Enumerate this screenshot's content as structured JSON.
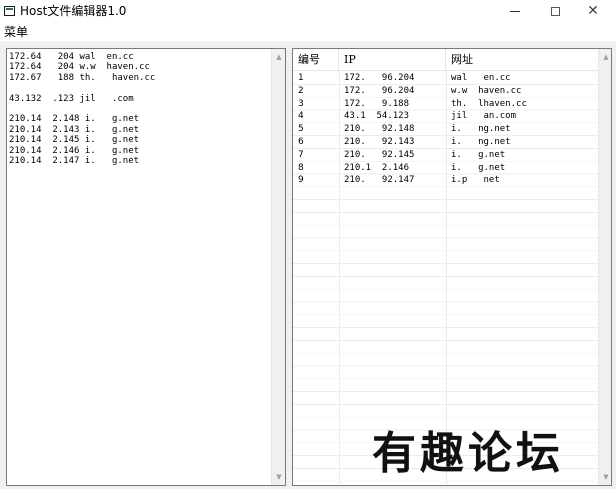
{
  "window": {
    "title": "Host文件编辑器1.0"
  },
  "menubar": {
    "menu_label": "菜单"
  },
  "editor": {
    "lines": [
      "172.64   204 wal  en.cc",
      "172.64   204 w.w  haven.cc",
      "172.67   188 th.   haven.cc",
      "",
      "43.132  .123 jil   .com",
      "",
      "210.14  2.148 i.   g.net",
      "210.14  2.143 i.   g.net",
      "210.14  2.145 i.   g.net",
      "210.14  2.146 i.   g.net",
      "210.14  2.147 i.   g.net"
    ]
  },
  "table": {
    "headers": {
      "num": "编号",
      "ip": "IP",
      "site": "网址"
    },
    "rows": [
      {
        "num": "1",
        "ip": "172.   96.204",
        "site": "wal   en.cc"
      },
      {
        "num": "2",
        "ip": "172.   96.204",
        "site": "w.w  haven.cc"
      },
      {
        "num": "3",
        "ip": "172.   9.188",
        "site": "th.  lhaven.cc"
      },
      {
        "num": "4",
        "ip": "43.1  54.123",
        "site": "jil   an.com"
      },
      {
        "num": "5",
        "ip": "210.   92.148",
        "site": "i.   ng.net"
      },
      {
        "num": "6",
        "ip": "210.   92.143",
        "site": "i.   ng.net"
      },
      {
        "num": "7",
        "ip": "210.   92.145",
        "site": "i.   g.net"
      },
      {
        "num": "8",
        "ip": "210.1  2.146",
        "site": "i.   g.net"
      },
      {
        "num": "9",
        "ip": "210.   92.147",
        "site": "i.p   net"
      }
    ]
  },
  "watermark": {
    "text": "有趣论坛"
  },
  "icons": {
    "minimize": "minimize-icon",
    "maximize": "maximize-icon",
    "close": "close-icon",
    "scroll_up": "scroll-up-arrow-icon",
    "scroll_down": "scroll-down-arrow-icon"
  }
}
